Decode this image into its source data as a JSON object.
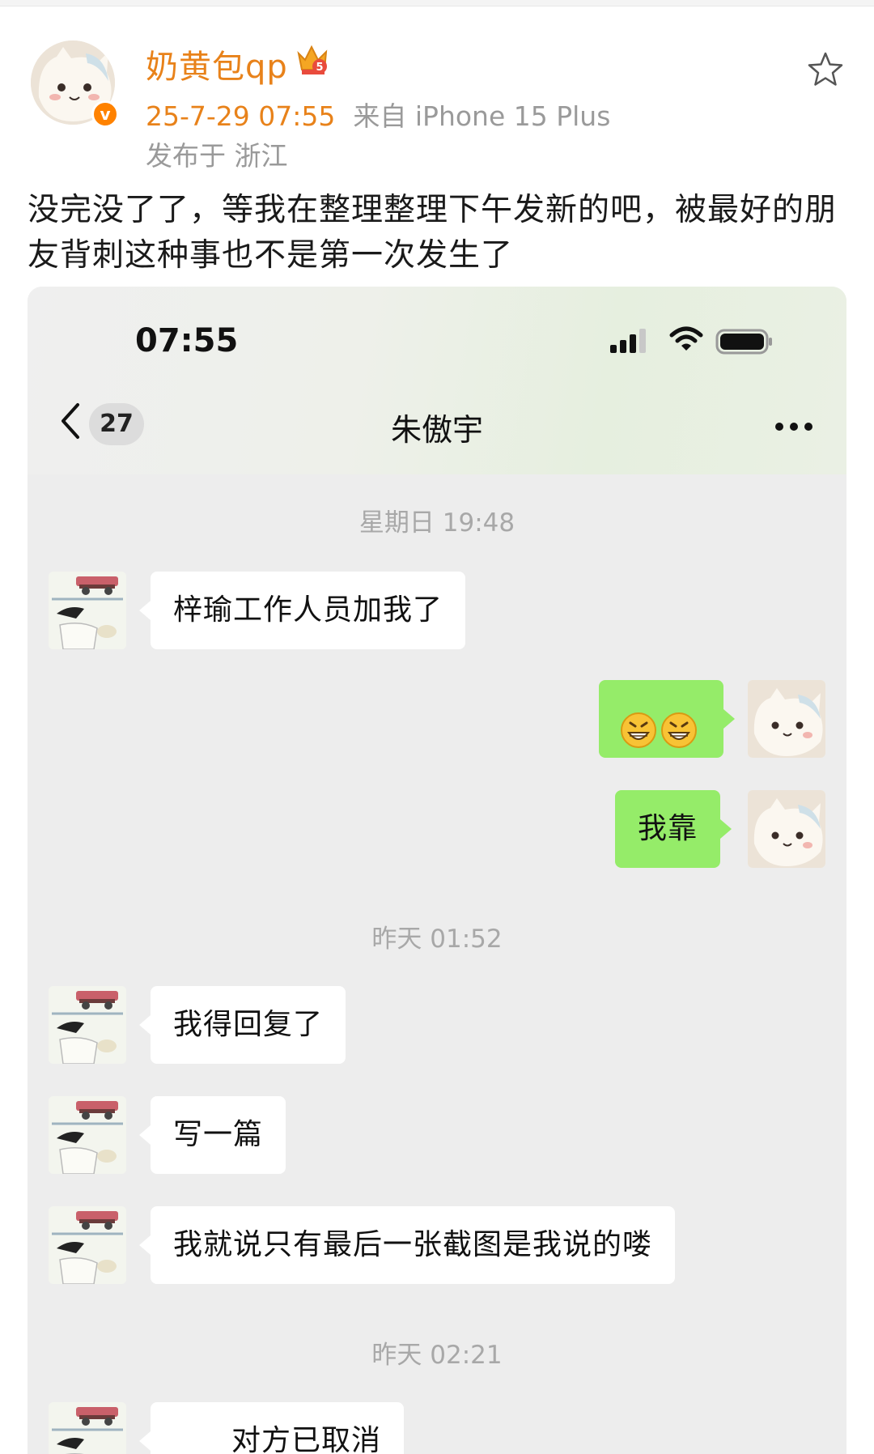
{
  "post": {
    "username": "奶黄包qp",
    "verified_badge": "v",
    "time": "25-7-29 07:55",
    "source": "来自 iPhone 15 Plus",
    "location": "发布于 浙江",
    "text": "没完没了了，等我在整理整理下午发新的吧，被最好的朋友背刺这种事也不是第一次发生了",
    "icons": [
      "crown-badge-icon",
      "star-icon"
    ]
  },
  "chat_screenshot": {
    "status_bar": {
      "time": "07:55"
    },
    "nav": {
      "unread_count": "27",
      "title": "朱傲宇"
    },
    "timestamps": [
      "星期日 19:48",
      "昨天 01:52",
      "昨天 02:21"
    ],
    "messages": [
      {
        "side": "left",
        "text": "梓瑜工作人员加我了"
      },
      {
        "side": "right",
        "text": "",
        "emoji": [
          "grin-emoji",
          "grin-emoji"
        ]
      },
      {
        "side": "right",
        "text": "我靠"
      },
      {
        "side": "left",
        "text": "我得回复了"
      },
      {
        "side": "left",
        "text": "写一篇"
      },
      {
        "side": "left",
        "text": "我就说只有最后一张截图是我说的喽"
      },
      {
        "side": "left",
        "text": "对方已取消",
        "icon": "phone-call-icon"
      }
    ],
    "colors": {
      "sent_bubble": "#95ec69",
      "received_bubble": "#ffffff",
      "background": "#ededed"
    }
  }
}
